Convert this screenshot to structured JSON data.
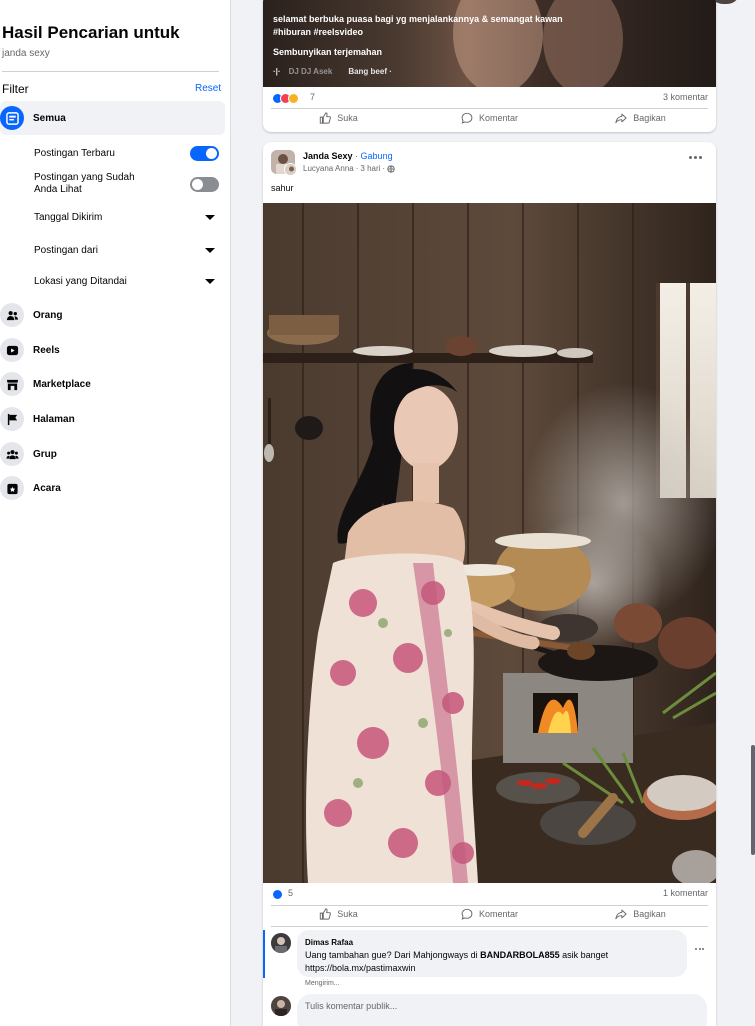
{
  "sidebar": {
    "title": "Hasil Pencarian untuk",
    "query": "janda sexy",
    "filter_label": "Filter",
    "reset_label": "Reset",
    "active_item": {
      "label": "Semua",
      "icon": "feed-icon"
    },
    "sub_items": [
      {
        "label": "Postingan Terbaru",
        "control": "toggle",
        "state": "on"
      },
      {
        "label": "Postingan yang Sudah Anda Lihat",
        "control": "toggle",
        "state": "off"
      },
      {
        "label": "Tanggal Dikirim",
        "control": "dropdown"
      },
      {
        "label": "Postingan dari",
        "control": "dropdown"
      },
      {
        "label": "Lokasi yang Ditandai",
        "control": "dropdown"
      }
    ],
    "items": [
      {
        "label": "Orang",
        "icon": "people-icon"
      },
      {
        "label": "Reels",
        "icon": "reels-icon"
      },
      {
        "label": "Marketplace",
        "icon": "marketplace-icon"
      },
      {
        "label": "Halaman",
        "icon": "flag-icon"
      },
      {
        "label": "Grup",
        "icon": "group-icon"
      },
      {
        "label": "Acara",
        "icon": "calendar-star-icon"
      }
    ]
  },
  "post1": {
    "caption_line1": "selamat berbuka puasa bagi yg menjalankannya & semangat kawan",
    "caption_line2": "#hiburan #reelsvideo",
    "hide_translation": "Sembunyikan terjemahan",
    "audio_artist": "DJ DJ Asek",
    "audio_title": "Bang beef ·",
    "reaction_count": "7",
    "comment_count": "3 komentar",
    "actions": {
      "like": "Suka",
      "comment": "Komentar",
      "share": "Bagikan"
    }
  },
  "post2": {
    "group_name": "Janda Sexy",
    "join_label": "Gabung",
    "author": "Lucyana Anna",
    "time": "3 hari",
    "caption": "sahur",
    "reaction_count": "5",
    "comment_count": "1 komentar",
    "actions": {
      "like": "Suka",
      "comment": "Komentar",
      "share": "Bagikan"
    },
    "comment": {
      "author": "Dimas Rafaa",
      "text_before": "Uang tambahan gue? Dari Mahjongways di ",
      "text_bold": "BANDARBOLA855",
      "text_after": " asik banget",
      "link": "https://bola.mx/pastimaxwin",
      "status": "Mengirim..."
    },
    "input_placeholder": "Tulis komentar publik..."
  },
  "colors": {
    "accent": "#0866ff",
    "text": "#050505",
    "muted": "#65676b",
    "bg": "#f0f2f5"
  }
}
